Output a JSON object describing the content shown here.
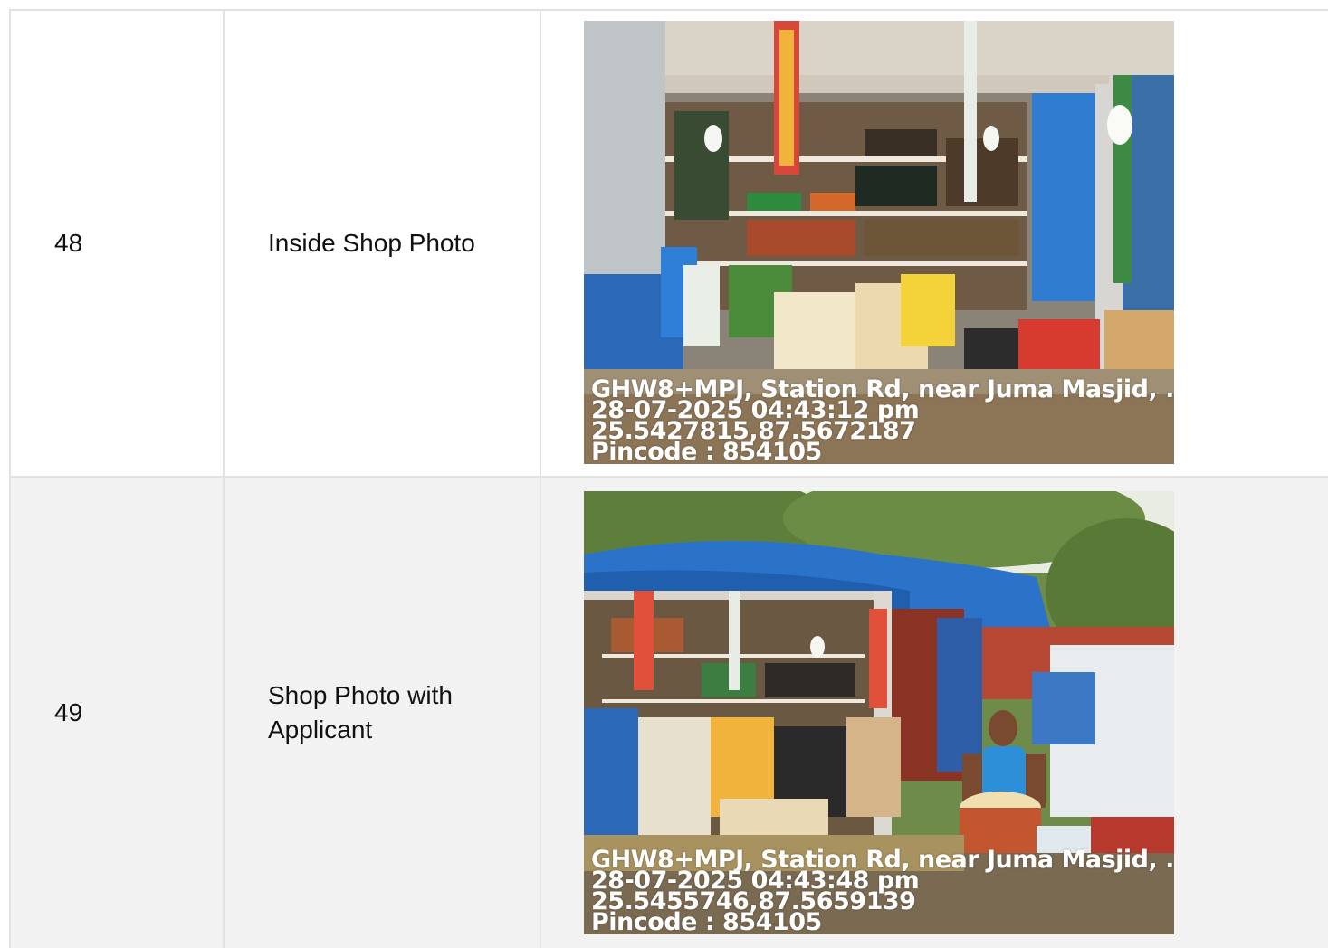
{
  "rows": [
    {
      "number": "48",
      "label": "Inside Shop Photo",
      "photo": {
        "subject": "shop-interior-photo",
        "stamp": [
          "GHW8+MPJ, Station Rd, near Juma Masjid, .",
          "28-07-2025 04:43:12 pm",
          "25.5427815,87.5672187",
          "Pincode : 854105"
        ]
      }
    },
    {
      "number": "49",
      "label": "Shop Photo with Applicant",
      "photo": {
        "subject": "shop-with-applicant-photo",
        "stamp": [
          "GHW8+MPJ, Station Rd, near Juma Masjid, .",
          "28-07-2025 04:43:48 pm",
          "25.5455746,87.5659139",
          "Pincode : 854105"
        ]
      }
    }
  ],
  "colors": {
    "border": "#e2e2e2",
    "row_alt_bg": "#f2f2f2",
    "tarp_blue": "#2a73c9"
  }
}
